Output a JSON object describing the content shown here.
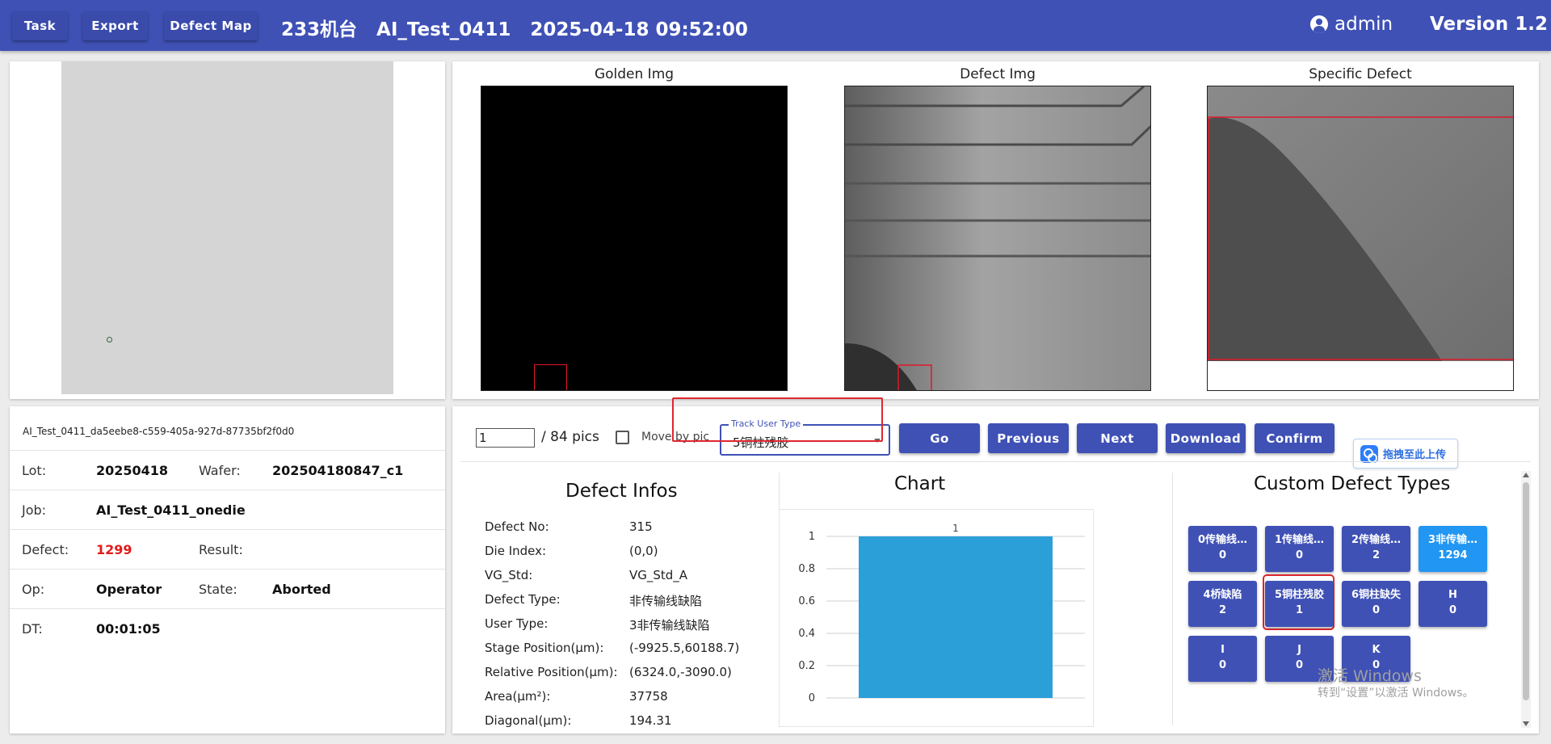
{
  "nav": {
    "task": "Task",
    "export": "Export",
    "defect_map": "Defect Map"
  },
  "header": {
    "title": "233机台   AI_Test_0411   2025-04-18 09:52:00",
    "user": "admin",
    "version": "Version 1.2"
  },
  "images": {
    "golden_title": "Golden Img",
    "defect_title": "Defect Img",
    "specific_title": "Specific Defect"
  },
  "info": {
    "id": "AI_Test_0411_da5eebe8-c559-405a-927d-87735bf2f0d0",
    "lot_label": "Lot:",
    "lot": "20250418",
    "wafer_label": "Wafer:",
    "wafer": "202504180847_c1",
    "job_label": "Job:",
    "job": "AI_Test_0411_onedie",
    "defect_label": "Defect:",
    "defect": "1299",
    "result_label": "Result:",
    "result": "",
    "op_label": "Op:",
    "op": "Operator",
    "state_label": "State:",
    "state": "Aborted",
    "dt_label": "DT:",
    "dt": "00:01:05"
  },
  "toolbar": {
    "page_value": "1",
    "page_total": "/ 84 pics",
    "move_by_pic": "Move by pic",
    "track_label": "Track User Type",
    "track_value": "5铜柱残胶",
    "go": "Go",
    "previous": "Previous",
    "next": "Next",
    "download": "Download",
    "confirm": "Confirm",
    "upload": "拖拽至此上传"
  },
  "defect_infos": {
    "title": "Defect Infos",
    "rows": [
      {
        "label": "Defect No:",
        "value": "315"
      },
      {
        "label": "Die Index:",
        "value": "(0,0)"
      },
      {
        "label": "VG_Std:",
        "value": "VG_Std_A"
      },
      {
        "label": "Defect Type:",
        "value": "非传输线缺陷"
      },
      {
        "label": "User Type:",
        "value": "3非传输线缺陷"
      },
      {
        "label": "Stage Position(μm):",
        "value": "(-9925.5,60188.7)"
      },
      {
        "label": "Relative Position(μm):",
        "value": "(6324.0,-3090.0)"
      },
      {
        "label": "Area(μm²):",
        "value": "37758"
      },
      {
        "label": "Diagonal(μm):",
        "value": "194.31"
      }
    ]
  },
  "chart_title": "Chart",
  "chart_data": {
    "type": "bar",
    "categories": [
      ""
    ],
    "values": [
      1
    ],
    "data_labels": [
      "1"
    ],
    "ylim": [
      0,
      1
    ],
    "yticks": [
      "0",
      "0.2",
      "0.4",
      "0.6",
      "0.8",
      "1"
    ],
    "title": "",
    "xlabel": "",
    "ylabel": "",
    "grid": true,
    "color": "#2a9fd8"
  },
  "custom_types": {
    "title": "Custom Defect Types",
    "items": [
      {
        "name": "0传输线…",
        "count": "0"
      },
      {
        "name": "1传输线…",
        "count": "0"
      },
      {
        "name": "2传输线…",
        "count": "2"
      },
      {
        "name": "3非传输…",
        "count": "1294"
      },
      {
        "name": "4桥缺陷",
        "count": "2"
      },
      {
        "name": "5铜柱残胶",
        "count": "1"
      },
      {
        "name": "6铜柱缺失",
        "count": "0"
      },
      {
        "name": "H",
        "count": "0"
      },
      {
        "name": "I",
        "count": "0"
      },
      {
        "name": "J",
        "count": "0"
      },
      {
        "name": "K",
        "count": "0"
      }
    ]
  },
  "watermark": {
    "line1": "激活 Windows",
    "line2": "转到“设置”以激活 Windows。"
  },
  "colors": {
    "primary": "#3f51b5",
    "active": "#2196f3",
    "alert": "#e01b1b",
    "bar": "#2a9fd8"
  }
}
